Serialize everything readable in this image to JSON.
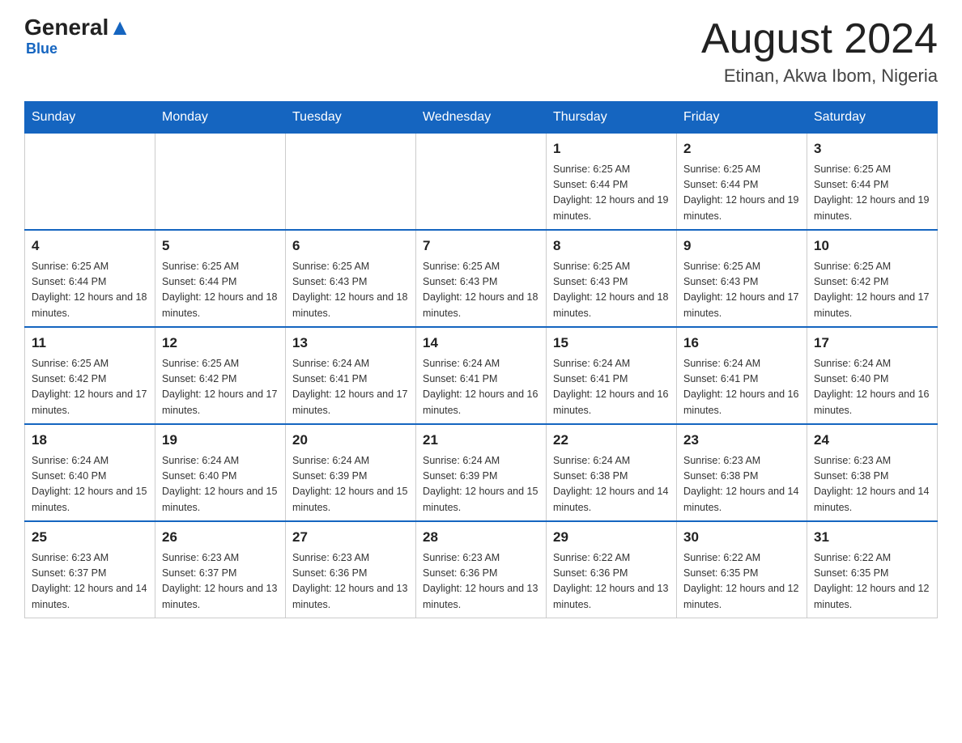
{
  "header": {
    "logo_general": "General",
    "logo_blue": "Blue",
    "month_year": "August 2024",
    "location": "Etinan, Akwa Ibom, Nigeria"
  },
  "days_of_week": [
    "Sunday",
    "Monday",
    "Tuesday",
    "Wednesday",
    "Thursday",
    "Friday",
    "Saturday"
  ],
  "weeks": [
    {
      "cells": [
        {
          "day": "",
          "info": ""
        },
        {
          "day": "",
          "info": ""
        },
        {
          "day": "",
          "info": ""
        },
        {
          "day": "",
          "info": ""
        },
        {
          "day": "1",
          "info": "Sunrise: 6:25 AM\nSunset: 6:44 PM\nDaylight: 12 hours and 19 minutes."
        },
        {
          "day": "2",
          "info": "Sunrise: 6:25 AM\nSunset: 6:44 PM\nDaylight: 12 hours and 19 minutes."
        },
        {
          "day": "3",
          "info": "Sunrise: 6:25 AM\nSunset: 6:44 PM\nDaylight: 12 hours and 19 minutes."
        }
      ]
    },
    {
      "cells": [
        {
          "day": "4",
          "info": "Sunrise: 6:25 AM\nSunset: 6:44 PM\nDaylight: 12 hours and 18 minutes."
        },
        {
          "day": "5",
          "info": "Sunrise: 6:25 AM\nSunset: 6:44 PM\nDaylight: 12 hours and 18 minutes."
        },
        {
          "day": "6",
          "info": "Sunrise: 6:25 AM\nSunset: 6:43 PM\nDaylight: 12 hours and 18 minutes."
        },
        {
          "day": "7",
          "info": "Sunrise: 6:25 AM\nSunset: 6:43 PM\nDaylight: 12 hours and 18 minutes."
        },
        {
          "day": "8",
          "info": "Sunrise: 6:25 AM\nSunset: 6:43 PM\nDaylight: 12 hours and 18 minutes."
        },
        {
          "day": "9",
          "info": "Sunrise: 6:25 AM\nSunset: 6:43 PM\nDaylight: 12 hours and 17 minutes."
        },
        {
          "day": "10",
          "info": "Sunrise: 6:25 AM\nSunset: 6:42 PM\nDaylight: 12 hours and 17 minutes."
        }
      ]
    },
    {
      "cells": [
        {
          "day": "11",
          "info": "Sunrise: 6:25 AM\nSunset: 6:42 PM\nDaylight: 12 hours and 17 minutes."
        },
        {
          "day": "12",
          "info": "Sunrise: 6:25 AM\nSunset: 6:42 PM\nDaylight: 12 hours and 17 minutes."
        },
        {
          "day": "13",
          "info": "Sunrise: 6:24 AM\nSunset: 6:41 PM\nDaylight: 12 hours and 17 minutes."
        },
        {
          "day": "14",
          "info": "Sunrise: 6:24 AM\nSunset: 6:41 PM\nDaylight: 12 hours and 16 minutes."
        },
        {
          "day": "15",
          "info": "Sunrise: 6:24 AM\nSunset: 6:41 PM\nDaylight: 12 hours and 16 minutes."
        },
        {
          "day": "16",
          "info": "Sunrise: 6:24 AM\nSunset: 6:41 PM\nDaylight: 12 hours and 16 minutes."
        },
        {
          "day": "17",
          "info": "Sunrise: 6:24 AM\nSunset: 6:40 PM\nDaylight: 12 hours and 16 minutes."
        }
      ]
    },
    {
      "cells": [
        {
          "day": "18",
          "info": "Sunrise: 6:24 AM\nSunset: 6:40 PM\nDaylight: 12 hours and 15 minutes."
        },
        {
          "day": "19",
          "info": "Sunrise: 6:24 AM\nSunset: 6:40 PM\nDaylight: 12 hours and 15 minutes."
        },
        {
          "day": "20",
          "info": "Sunrise: 6:24 AM\nSunset: 6:39 PM\nDaylight: 12 hours and 15 minutes."
        },
        {
          "day": "21",
          "info": "Sunrise: 6:24 AM\nSunset: 6:39 PM\nDaylight: 12 hours and 15 minutes."
        },
        {
          "day": "22",
          "info": "Sunrise: 6:24 AM\nSunset: 6:38 PM\nDaylight: 12 hours and 14 minutes."
        },
        {
          "day": "23",
          "info": "Sunrise: 6:23 AM\nSunset: 6:38 PM\nDaylight: 12 hours and 14 minutes."
        },
        {
          "day": "24",
          "info": "Sunrise: 6:23 AM\nSunset: 6:38 PM\nDaylight: 12 hours and 14 minutes."
        }
      ]
    },
    {
      "cells": [
        {
          "day": "25",
          "info": "Sunrise: 6:23 AM\nSunset: 6:37 PM\nDaylight: 12 hours and 14 minutes."
        },
        {
          "day": "26",
          "info": "Sunrise: 6:23 AM\nSunset: 6:37 PM\nDaylight: 12 hours and 13 minutes."
        },
        {
          "day": "27",
          "info": "Sunrise: 6:23 AM\nSunset: 6:36 PM\nDaylight: 12 hours and 13 minutes."
        },
        {
          "day": "28",
          "info": "Sunrise: 6:23 AM\nSunset: 6:36 PM\nDaylight: 12 hours and 13 minutes."
        },
        {
          "day": "29",
          "info": "Sunrise: 6:22 AM\nSunset: 6:36 PM\nDaylight: 12 hours and 13 minutes."
        },
        {
          "day": "30",
          "info": "Sunrise: 6:22 AM\nSunset: 6:35 PM\nDaylight: 12 hours and 12 minutes."
        },
        {
          "day": "31",
          "info": "Sunrise: 6:22 AM\nSunset: 6:35 PM\nDaylight: 12 hours and 12 minutes."
        }
      ]
    }
  ]
}
